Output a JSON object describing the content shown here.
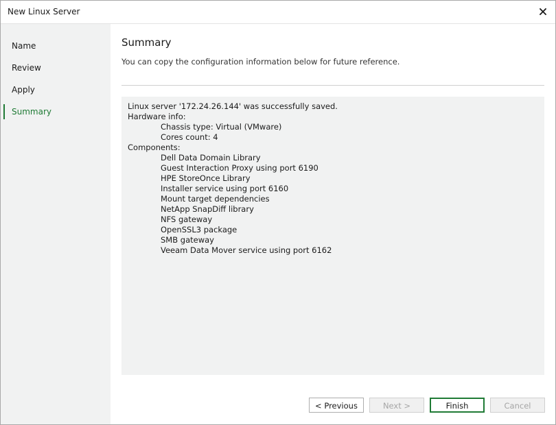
{
  "window": {
    "title": "New Linux Server"
  },
  "sidebar": {
    "items": [
      {
        "label": "Name"
      },
      {
        "label": "Review"
      },
      {
        "label": "Apply"
      },
      {
        "label": "Summary"
      }
    ],
    "active_index": 3
  },
  "main": {
    "title": "Summary",
    "description": "You can copy the configuration information below for future reference.",
    "summary": {
      "saved_line": "Linux server '172.24.26.144' was successfully saved.",
      "hardware_header": "Hardware info:",
      "hardware": [
        "Chassis type: Virtual (VMware)",
        "Cores count: 4"
      ],
      "components_header": "Components:",
      "components": [
        "Dell Data Domain Library",
        "Guest Interaction Proxy using port 6190",
        "HPE StoreOnce Library",
        "Installer service using port 6160",
        "Mount target dependencies",
        "NetApp SnapDiff library",
        "NFS gateway",
        "OpenSSL3 package",
        "SMB gateway",
        "Veeam Data Mover service using port 6162"
      ]
    }
  },
  "buttons": {
    "previous": "< Previous",
    "next": "Next >",
    "finish": "Finish",
    "cancel": "Cancel"
  },
  "colors": {
    "accent": "#1e7a34",
    "sidebar_bg": "#f1f2f2",
    "summary_bg": "#f1f2f2"
  }
}
